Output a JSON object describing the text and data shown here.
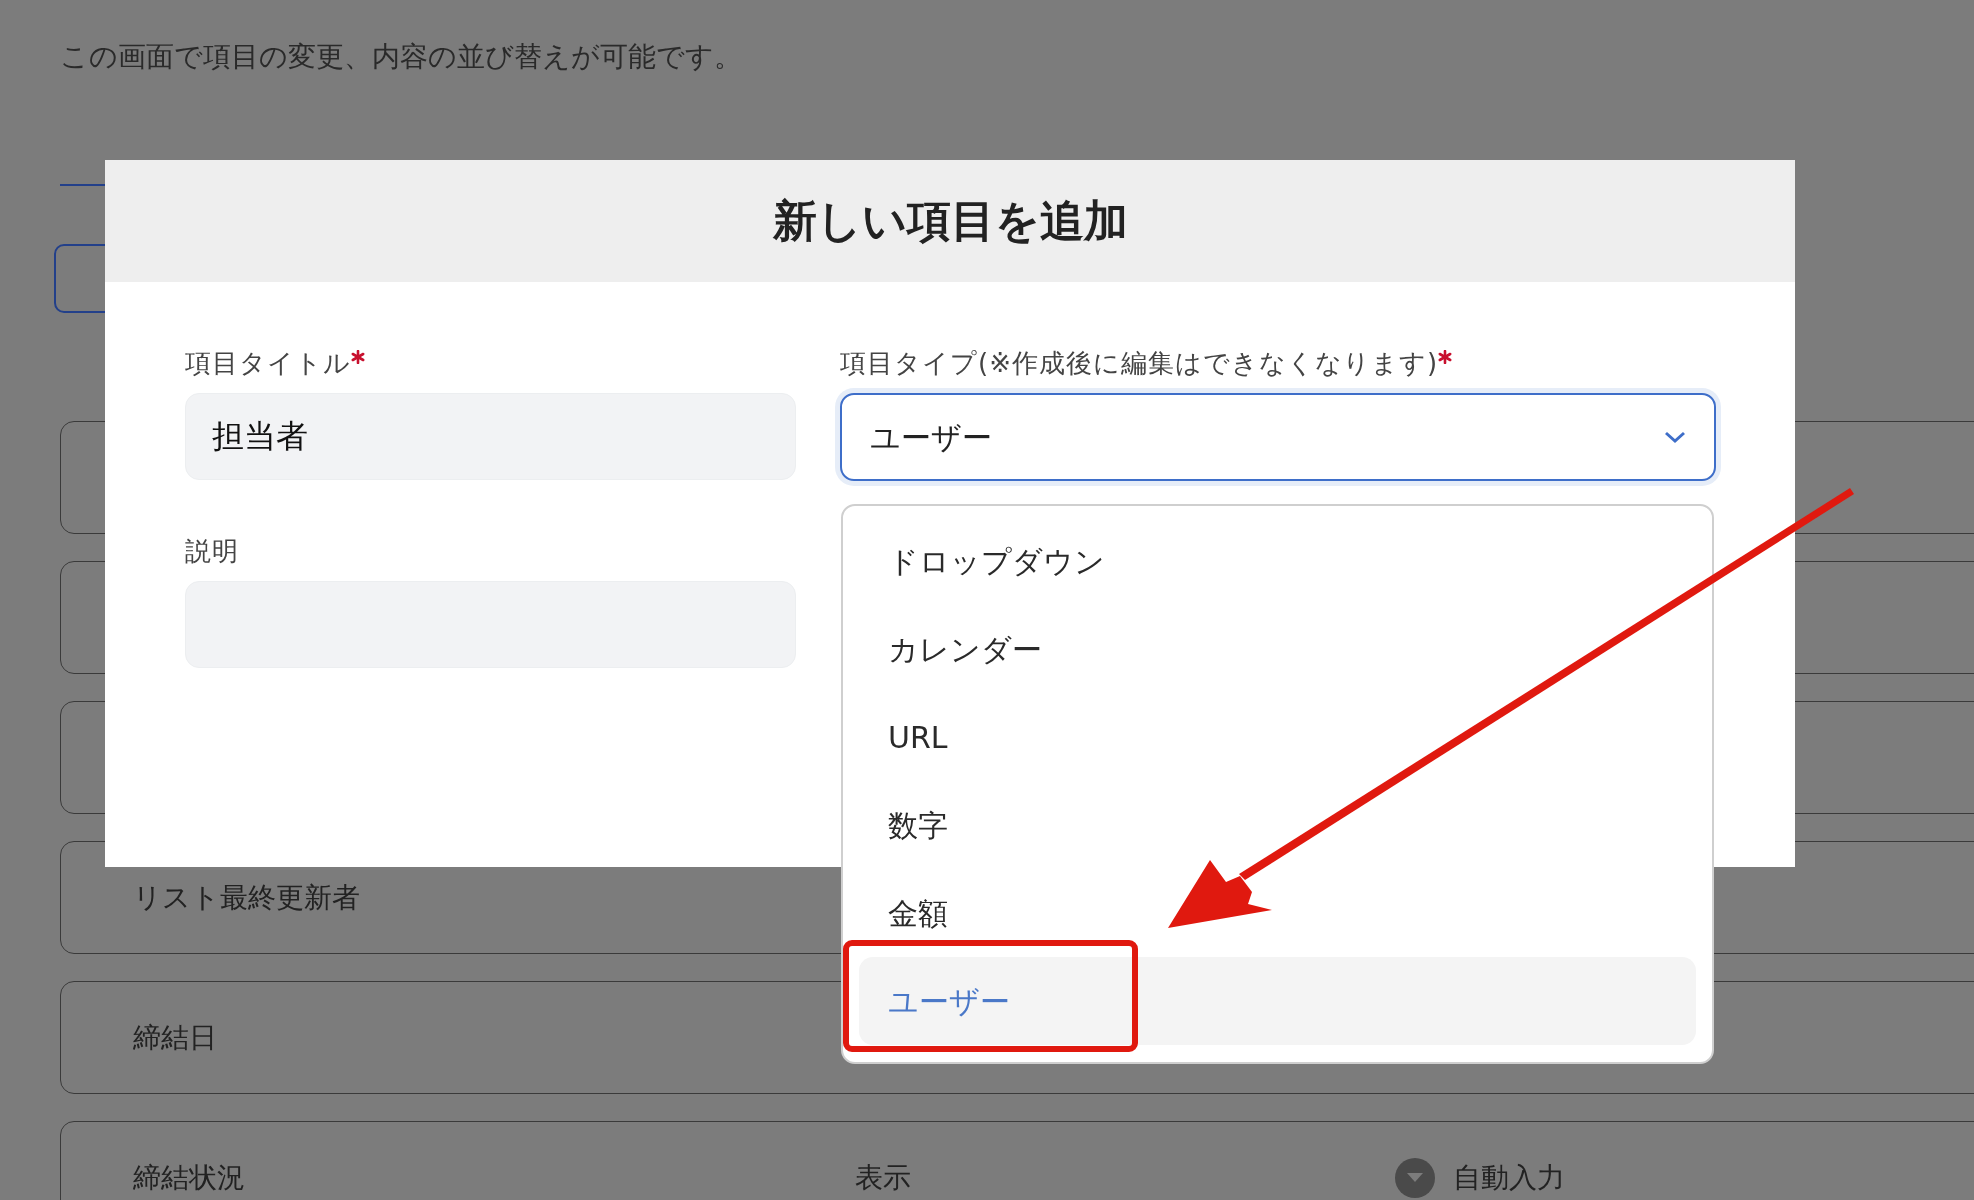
{
  "page": {
    "description": "この画面で項目の変更、内容の並び替えが可能です。",
    "rows": [
      {},
      {},
      {},
      {
        "label": "リスト最終更新者"
      },
      {
        "label": "締結日"
      },
      {
        "label": "締結状況",
        "visibility": "表示",
        "input": "自動入力"
      }
    ]
  },
  "modal": {
    "title": "新しい項目を追加",
    "title_field": {
      "label": "項目タイトル",
      "required": true,
      "value": "担当者"
    },
    "type_field": {
      "label": "項目タイプ(※作成後に編集はできなくなります)",
      "required": true,
      "value": "ユーザー",
      "expanded": true
    },
    "description_field": {
      "label": "説明"
    },
    "type_options": [
      {
        "label": "ドロップダウン",
        "selected": false
      },
      {
        "label": "カレンダー",
        "selected": false
      },
      {
        "label": "URL",
        "selected": false
      },
      {
        "label": "数字",
        "selected": false
      },
      {
        "label": "金額",
        "selected": false
      },
      {
        "label": "ユーザー",
        "selected": true
      }
    ]
  }
}
